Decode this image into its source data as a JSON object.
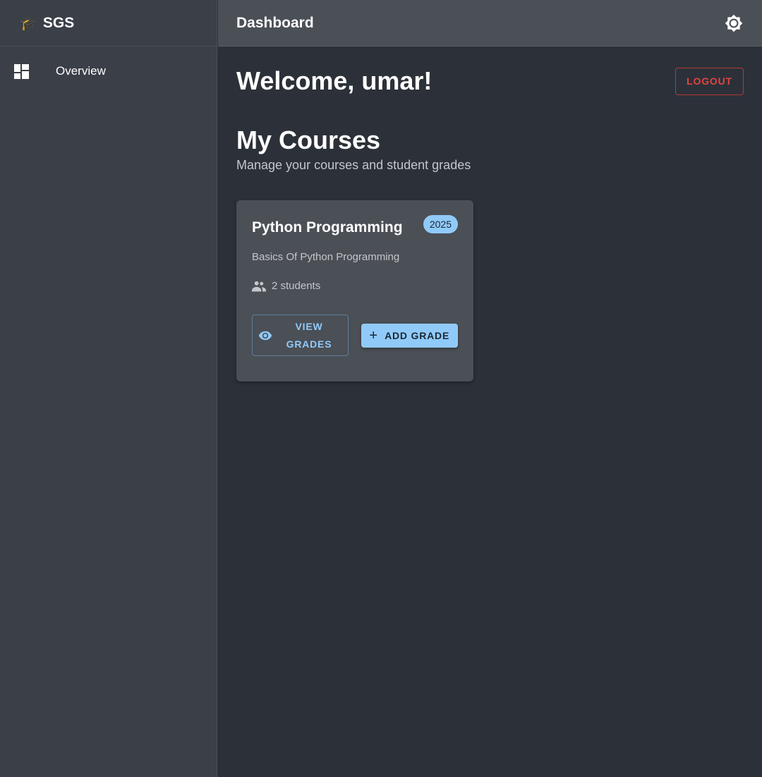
{
  "app": {
    "brand_icon": "🎓",
    "brand_name": "SGS"
  },
  "sidebar": {
    "items": [
      {
        "label": "Overview",
        "icon": "dashboard-icon"
      }
    ]
  },
  "header": {
    "title": "Dashboard",
    "theme_icon": "brightness-icon"
  },
  "main": {
    "welcome": "Welcome, umar!",
    "logout_label": "LOGOUT",
    "section_title": "My Courses",
    "section_subtitle": "Manage your courses and student grades",
    "courses": [
      {
        "title": "Python Programming",
        "year": "2025",
        "description": "Basics Of Python Programming",
        "students": "2 students",
        "view_label": "VIEW GRADES",
        "add_label": "ADD GRADE"
      }
    ]
  },
  "colors": {
    "background": "#2c3139",
    "sidebar": "#3a3f48",
    "topbar": "#4b4f56",
    "card": "#4b4f56",
    "accent": "#90caf9",
    "danger": "#e0453f"
  }
}
